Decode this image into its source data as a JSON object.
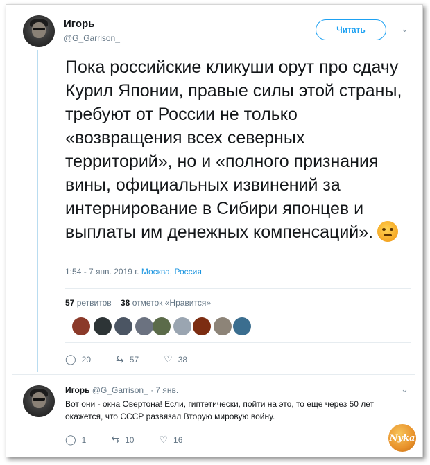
{
  "tweet": {
    "author_name": "Игорь",
    "author_handle": "@G_Garrison_",
    "follow_label": "Читать",
    "text": "Пока российские кликуши орут про сдачу Курил Японии, правые силы этой страны, требуют от России не только «возвращения всех северных территорий», но и «полного признания вины, официальных извинений за интернирование в Сибири японцев и выплаты им денежных компенсаций».",
    "emoji": "angry-face",
    "time": "1:54 - 7 янв. 2019 г.",
    "location": "Москва, Россия",
    "retweets_count": "57",
    "retweets_label": "ретвитов",
    "likes_count": "38",
    "likes_label": "отметок «Нравится»",
    "replies": "20",
    "retweets": "57",
    "likes": "38",
    "likers": [
      {
        "color": "#8b3a2a"
      },
      {
        "color": "#2d3436"
      },
      {
        "color": "#4b5563"
      },
      {
        "color": "#6b7280"
      },
      {
        "color": "#5b6b4a"
      },
      {
        "color": "#9aa5b1"
      },
      {
        "color": "#7c2d12"
      },
      {
        "color": "#8d8478"
      },
      {
        "color": "#3b6e8f"
      }
    ]
  },
  "reply": {
    "author_name": "Игорь",
    "author_handle": "@G_Garrison_",
    "date": "· 7 янв.",
    "text": "Вот они - окна Овертона! Если, гиптетически, пойти на это, то еще через 50 лет окажется, что СССР развязал Вторую мировую войну.",
    "replies": "1",
    "retweets": "10",
    "likes": "16"
  },
  "watermark": "Nyka",
  "colors": {
    "accent": "#1da1f2",
    "muted": "#657786",
    "link": "#1b95e0"
  }
}
